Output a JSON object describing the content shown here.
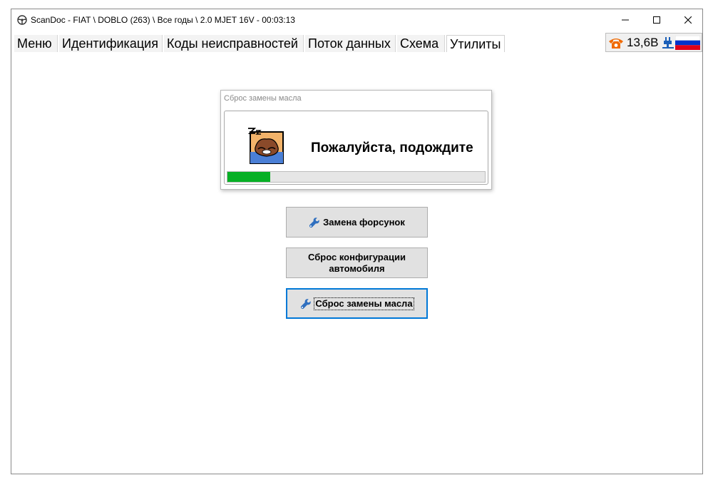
{
  "window": {
    "title": "ScanDoc - FIAT \\ DOBLO (263) \\ Все годы \\ 2.0 MJET 16V - 00:03:13",
    "controls": [
      "minimize-icon",
      "maximize-icon",
      "close-icon"
    ]
  },
  "menu": {
    "tabs": [
      {
        "label": "Меню"
      },
      {
        "label": "Идентификация"
      },
      {
        "label": "Коды неисправностей"
      },
      {
        "label": "Поток данных"
      },
      {
        "label": "Схема"
      },
      {
        "label": "Утилиты",
        "active": true
      }
    ]
  },
  "status": {
    "voltage": "13,6В",
    "icons": [
      "phone-icon",
      "plug-icon",
      "russia-flag-icon"
    ],
    "colors": {
      "phone": "#f06a00",
      "plug": "#1b5fb8"
    }
  },
  "dialog": {
    "title": "Сброс замены масла",
    "message": "Пожалуйста, подождите",
    "progress_fraction": 0.165,
    "progress_color": "#06b025",
    "icon": "sleeping-cat-icon"
  },
  "buttons": [
    {
      "label": "Замена форсунок",
      "icon": "wrench-icon"
    },
    {
      "label_line1": "Сброс конфигурации",
      "label_line2": "автомобиля"
    },
    {
      "label": "Сброс замены масла",
      "icon": "wrench-icon",
      "focused": true
    }
  ]
}
